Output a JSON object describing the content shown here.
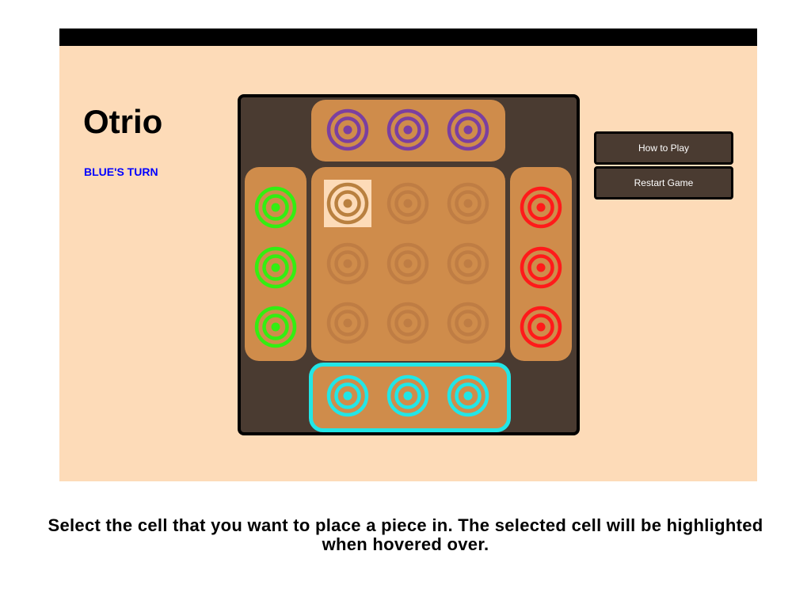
{
  "game": {
    "title": "Otrio",
    "turn_text": "BLUE'S TURN",
    "instructions": "Select the cell that you want to place a piece in. The selected cell will be highlighted when hovered over."
  },
  "buttons": {
    "how_to_play": "How to Play",
    "restart": "Restart Game"
  },
  "colors": {
    "purple": "#7b3fa0",
    "green": "#33ee11",
    "red": "#ff1a1a",
    "cyan": "#22e6e6",
    "empty_ring": "#bf7d44",
    "selected_ring": "#b9803f",
    "board_bg": "#4a3b31",
    "tray_bg": "#cf8c4b",
    "panel_bg": "#fddbb8"
  },
  "players": [
    {
      "name": "purple",
      "pieces": 3
    },
    {
      "name": "green",
      "pieces": 3
    },
    {
      "name": "red",
      "pieces": 3
    },
    {
      "name": "cyan",
      "pieces": 3
    }
  ],
  "current_player": "cyan",
  "board": {
    "rows": 3,
    "cols": 3,
    "selected_cell": [
      0,
      0
    ]
  },
  "icons": {
    "piece": "concentric-rings-icon"
  }
}
